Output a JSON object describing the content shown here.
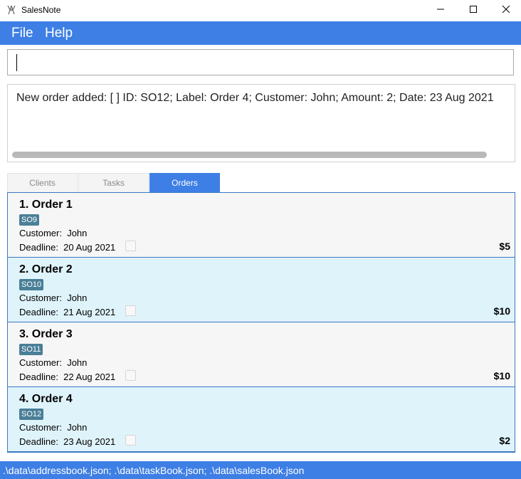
{
  "window": {
    "title": "SalesNote",
    "icon": "ribbon-icon"
  },
  "menu": {
    "file": "File",
    "help": "Help"
  },
  "command": {
    "value": ""
  },
  "result": {
    "text": "New order added: [ ] ID: SO12; Label: Order 4; Customer: John; Amount: 2; Date: 23 Aug 2021"
  },
  "tabs": [
    {
      "label": "Clients",
      "active": false
    },
    {
      "label": "Tasks",
      "active": false
    },
    {
      "label": "Orders",
      "active": true
    }
  ],
  "orders": [
    {
      "title": "1. Order 1",
      "id": "SO9",
      "customer_label": "Customer:",
      "customer": "John",
      "deadline_label": "Deadline:",
      "deadline": "20 Aug 2021",
      "amount": "$5",
      "done": false
    },
    {
      "title": "2. Order 2",
      "id": "SO10",
      "customer_label": "Customer:",
      "customer": "John",
      "deadline_label": "Deadline:",
      "deadline": "21 Aug 2021",
      "amount": "$10",
      "done": false
    },
    {
      "title": "3. Order 3",
      "id": "SO11",
      "customer_label": "Customer:",
      "customer": "John",
      "deadline_label": "Deadline:",
      "deadline": "22 Aug 2021",
      "amount": "$10",
      "done": false
    },
    {
      "title": "4. Order 4",
      "id": "SO12",
      "customer_label": "Customer:",
      "customer": "John",
      "deadline_label": "Deadline:",
      "deadline": "23 Aug 2021",
      "amount": "$2",
      "done": false
    }
  ],
  "status": {
    "text": ".\\data\\addressbook.json; .\\data\\taskBook.json; .\\data\\salesBook.json"
  },
  "colors": {
    "accent": "#3e7fe5",
    "tag": "#4a7f97",
    "row_alt": "#dff3fb",
    "row": "#f6f6f6"
  }
}
